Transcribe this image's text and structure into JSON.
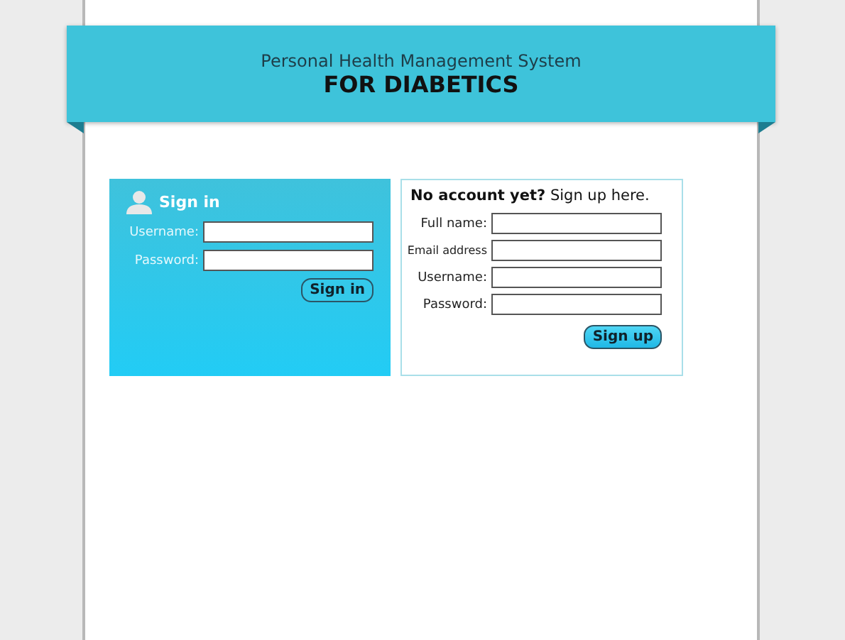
{
  "header": {
    "subtitle": "Personal Health Management System",
    "title": "FOR DIABETICS"
  },
  "sign_in": {
    "title": "Sign in",
    "fields": [
      {
        "label": "Username:"
      },
      {
        "label": "Password:"
      }
    ],
    "button": "Sign in"
  },
  "sign_up": {
    "heading": "**No account yet?** Sign up here.",
    "fields": [
      {
        "label": "Full name:"
      },
      {
        "label": "Email address"
      },
      {
        "label": "Username:"
      },
      {
        "label": "Password:"
      }
    ],
    "button": "Sign up"
  }
}
